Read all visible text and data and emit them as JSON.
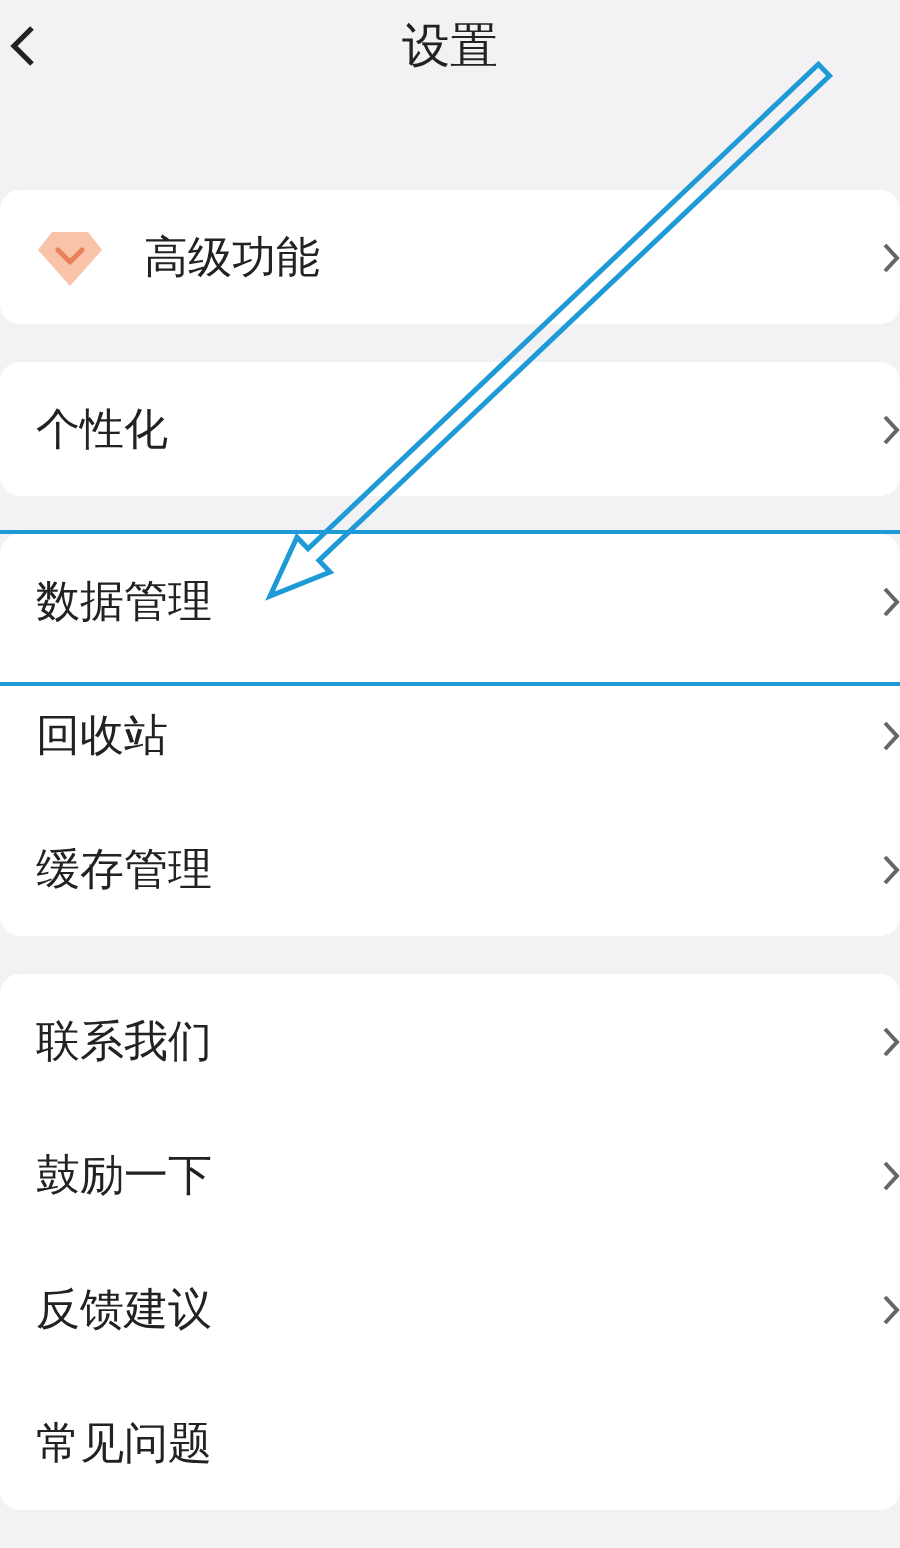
{
  "header": {
    "title": "设置"
  },
  "groups": [
    {
      "items": [
        {
          "label": "高级功能",
          "kind": "premium",
          "arrow": true,
          "highlighted": false
        }
      ]
    },
    {
      "items": [
        {
          "label": "个性化",
          "kind": "plain",
          "arrow": true,
          "highlighted": false
        }
      ]
    },
    {
      "items": [
        {
          "label": "数据管理",
          "kind": "plain",
          "arrow": true,
          "highlighted": true
        },
        {
          "label": "回收站",
          "kind": "plain",
          "arrow": true,
          "highlighted": false
        },
        {
          "label": "缓存管理",
          "kind": "plain",
          "arrow": true,
          "highlighted": false
        }
      ]
    },
    {
      "items": [
        {
          "label": "联系我们",
          "kind": "plain",
          "arrow": true,
          "highlighted": false
        },
        {
          "label": "鼓励一下",
          "kind": "plain",
          "arrow": true,
          "highlighted": false
        },
        {
          "label": "反馈建议",
          "kind": "plain",
          "arrow": true,
          "highlighted": false
        },
        {
          "label": "常见问题",
          "kind": "plain",
          "arrow": false,
          "highlighted": false
        }
      ]
    }
  ]
}
